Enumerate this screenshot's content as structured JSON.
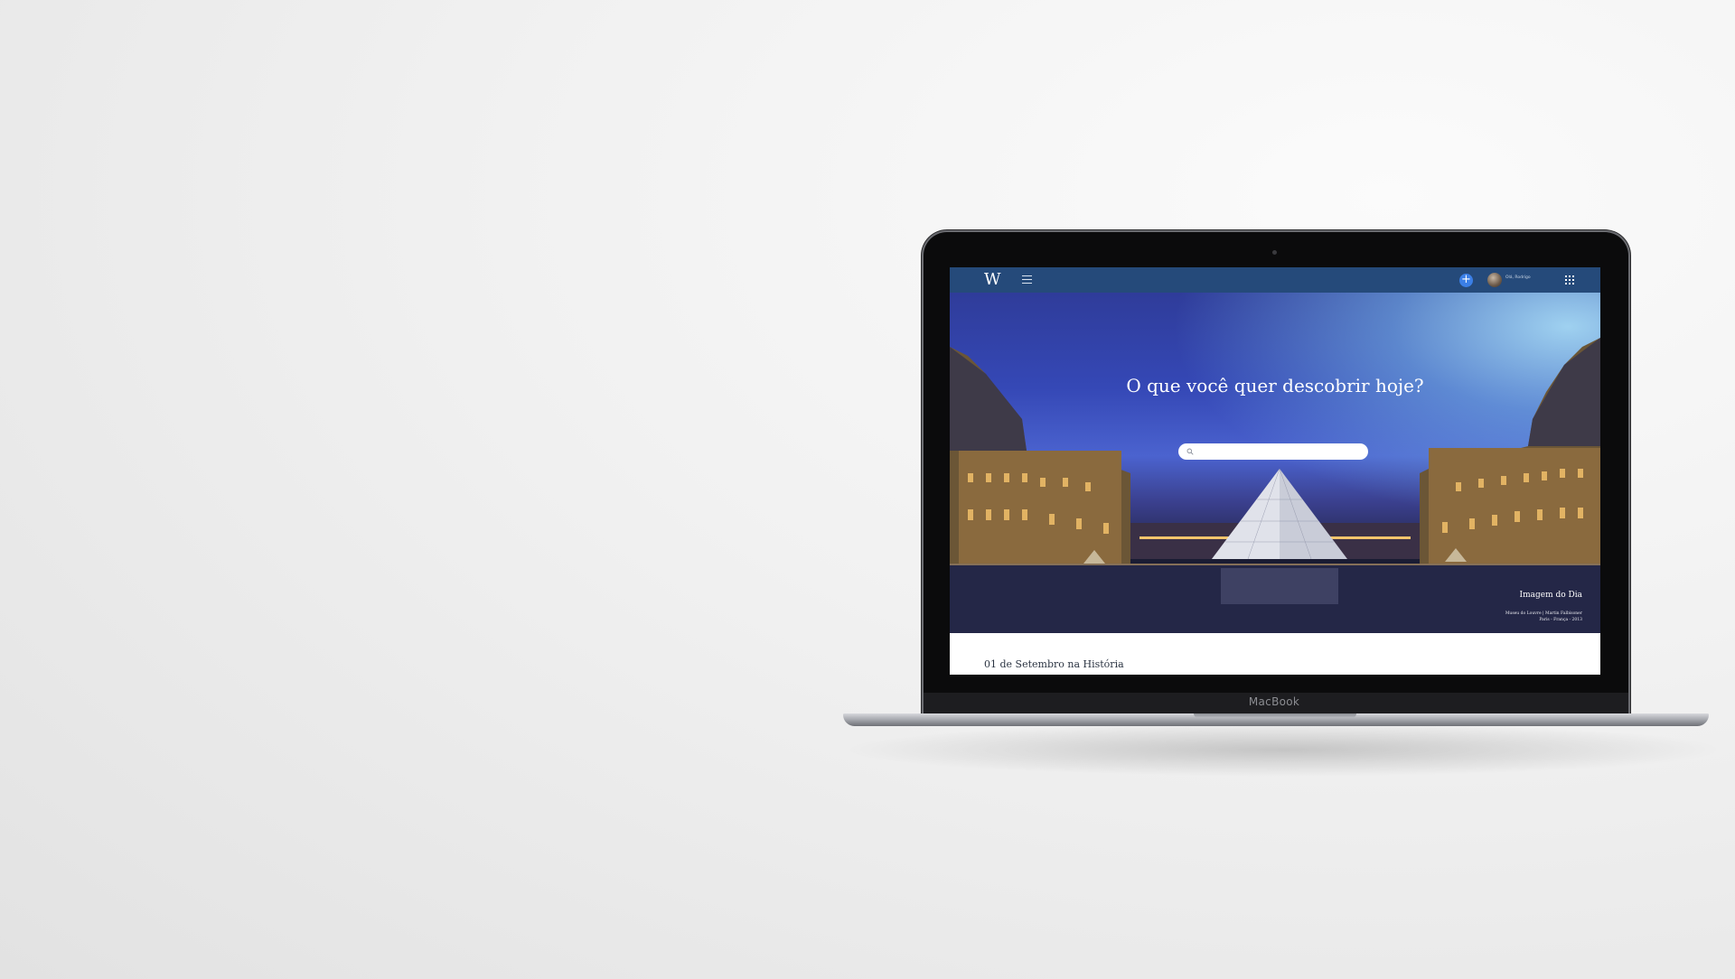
{
  "device": {
    "brand_label": "MacBook"
  },
  "site": {
    "logo_text": "W",
    "user_name": "Olá, Rodrigo",
    "plus_label": "+",
    "accent_color": "#3b7fe6",
    "header_color": "#254a7a",
    "icons": [
      "menu-icon",
      "plus-icon",
      "avatar",
      "apps-grid-icon",
      "search-icon"
    ]
  },
  "hero": {
    "title": "O que você quer descobrir hoje?",
    "search": {
      "value": "",
      "placeholder": ""
    },
    "caption": {
      "title": "Imagem do Dia",
      "line1": "Museu do Louvre | Martin Falbisoner",
      "line2": "Paris - França - 2013"
    }
  },
  "section": {
    "title": "01 de Setembro na História"
  }
}
